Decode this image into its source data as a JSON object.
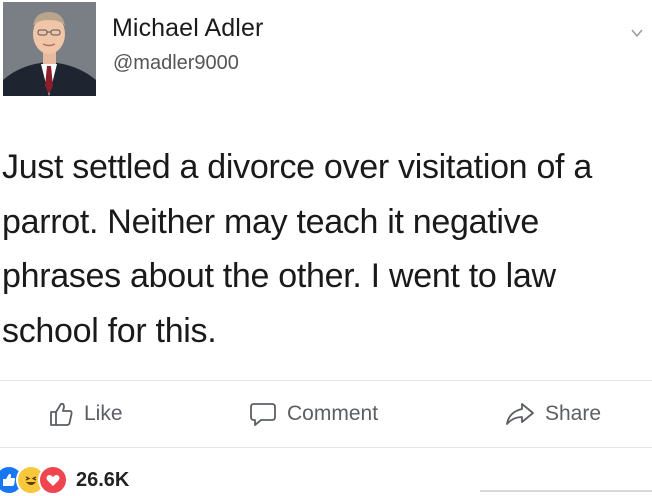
{
  "author": {
    "name": "Michael Adler",
    "handle": "@madler9000",
    "avatar_icon": "profile-photo"
  },
  "post": {
    "text": "Just settled a divorce over visitation of a parrot. Neither may teach it negative phrases about the other. I went to law school for this."
  },
  "actions": {
    "like_label": "Like",
    "comment_label": "Comment",
    "share_label": "Share"
  },
  "reactions": {
    "icons": [
      "like-reaction-icon",
      "haha-reaction-icon",
      "love-reaction-icon"
    ],
    "count": "26.6K"
  },
  "colors": {
    "like_blue": "#1877f2",
    "haha_yellow": "#f7c83c",
    "love_red": "#f0444f",
    "action_gray": "#5b5e63"
  }
}
